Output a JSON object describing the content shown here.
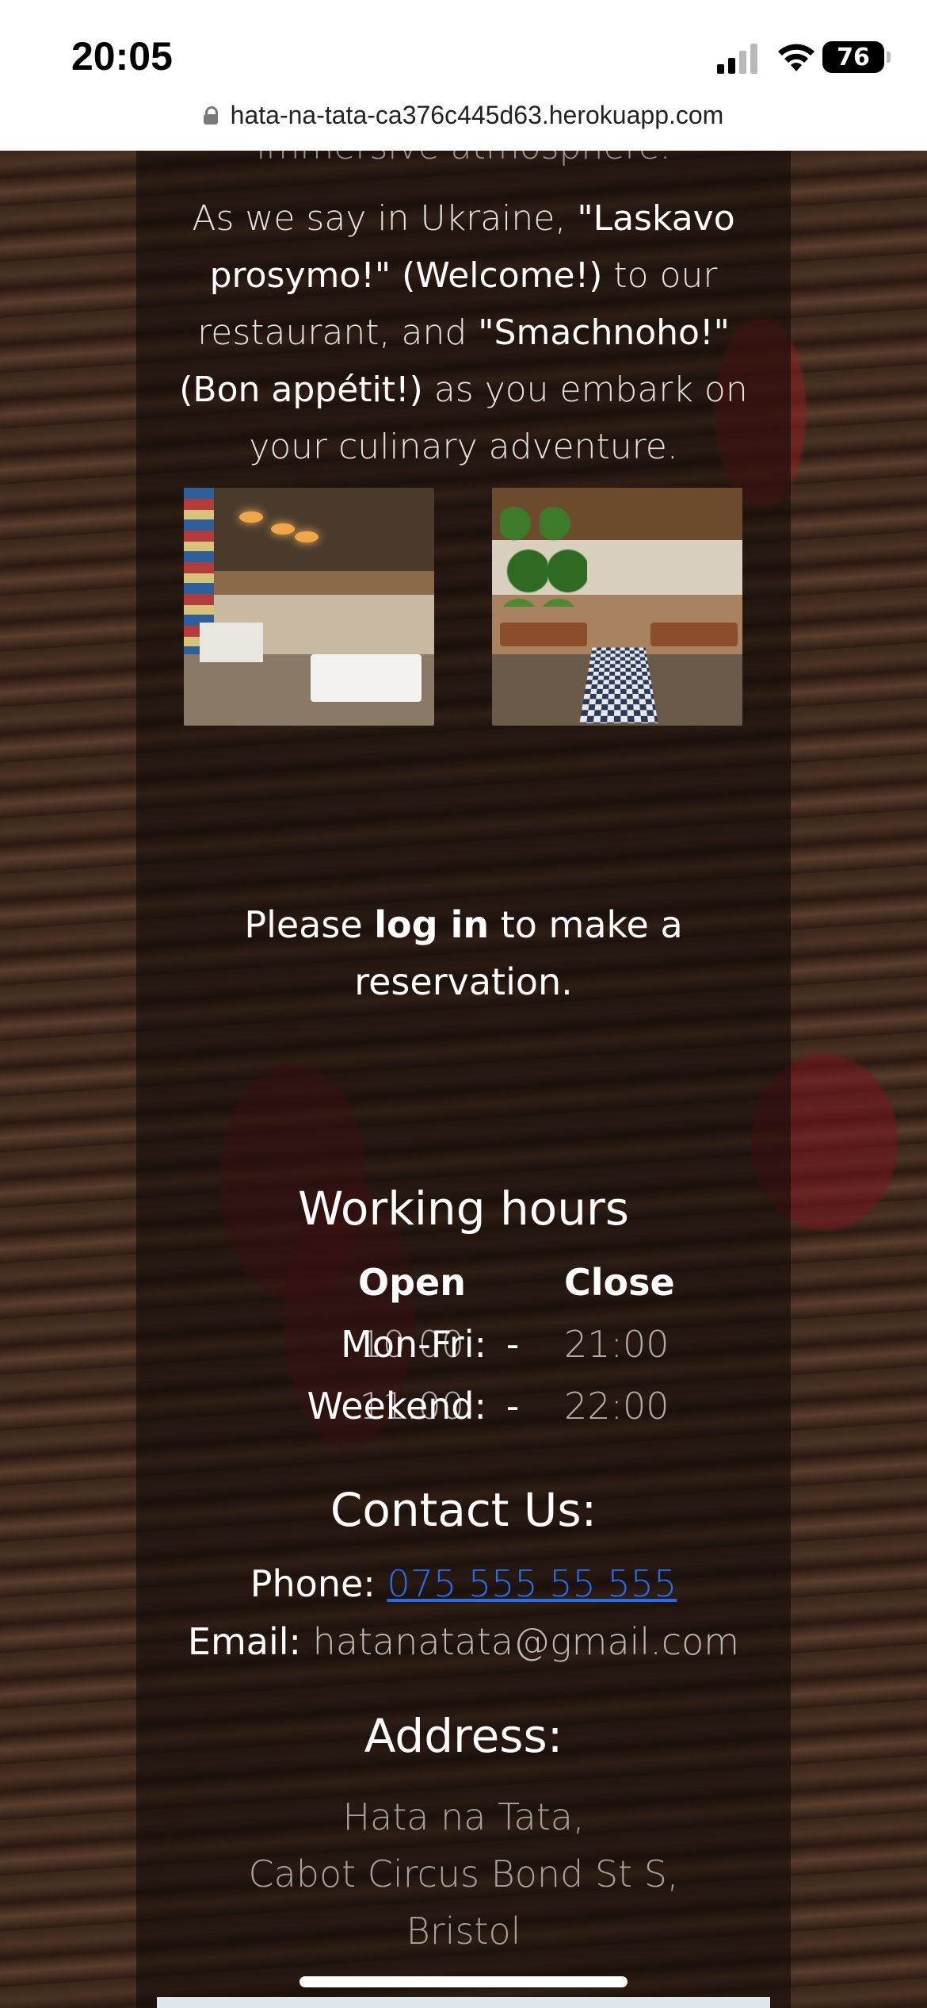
{
  "status_bar": {
    "time": "20:05",
    "battery": "76",
    "url": "hata-na-tata-ca376c445d63.herokuapp.com"
  },
  "intro": {
    "faded_line": "immersive atmosphere.",
    "p1": "As we say in Ukraine, ",
    "laskavo": "\"Laskavo prosymo!\"",
    "welcome": " (Welcome!)",
    "p2": " to our restaurant, and ",
    "smachnoho": "\"Smachnoho!\"",
    "bon": " (Bon appétit!)",
    "p3": " as you embark on your culinary adventure."
  },
  "photos": [
    {
      "alt": "restaurant interior photo 1"
    },
    {
      "alt": "restaurant interior photo 2"
    }
  ],
  "login": {
    "before": "Please ",
    "link": "log in",
    "after": " to make a reservation."
  },
  "hours": {
    "title": "Working hours",
    "head_open": "Open",
    "head_close": "Close",
    "rows": [
      {
        "label": "Mon-Fri:",
        "open": "10:00",
        "dash": "-",
        "close": "21:00"
      },
      {
        "label": "Weekend:",
        "open": "11:00",
        "dash": "-",
        "close": "22:00"
      }
    ]
  },
  "contact": {
    "title": "Contact Us:",
    "phone_label": "Phone: ",
    "phone": "075 555 55 555",
    "email_label": "Email: ",
    "email": "hatanatata@gmail.com"
  },
  "address": {
    "title": "Address:",
    "line1": "Hata na Tata,",
    "line2": "Cabot Circus Bond St S,",
    "line3": "Bristol"
  }
}
